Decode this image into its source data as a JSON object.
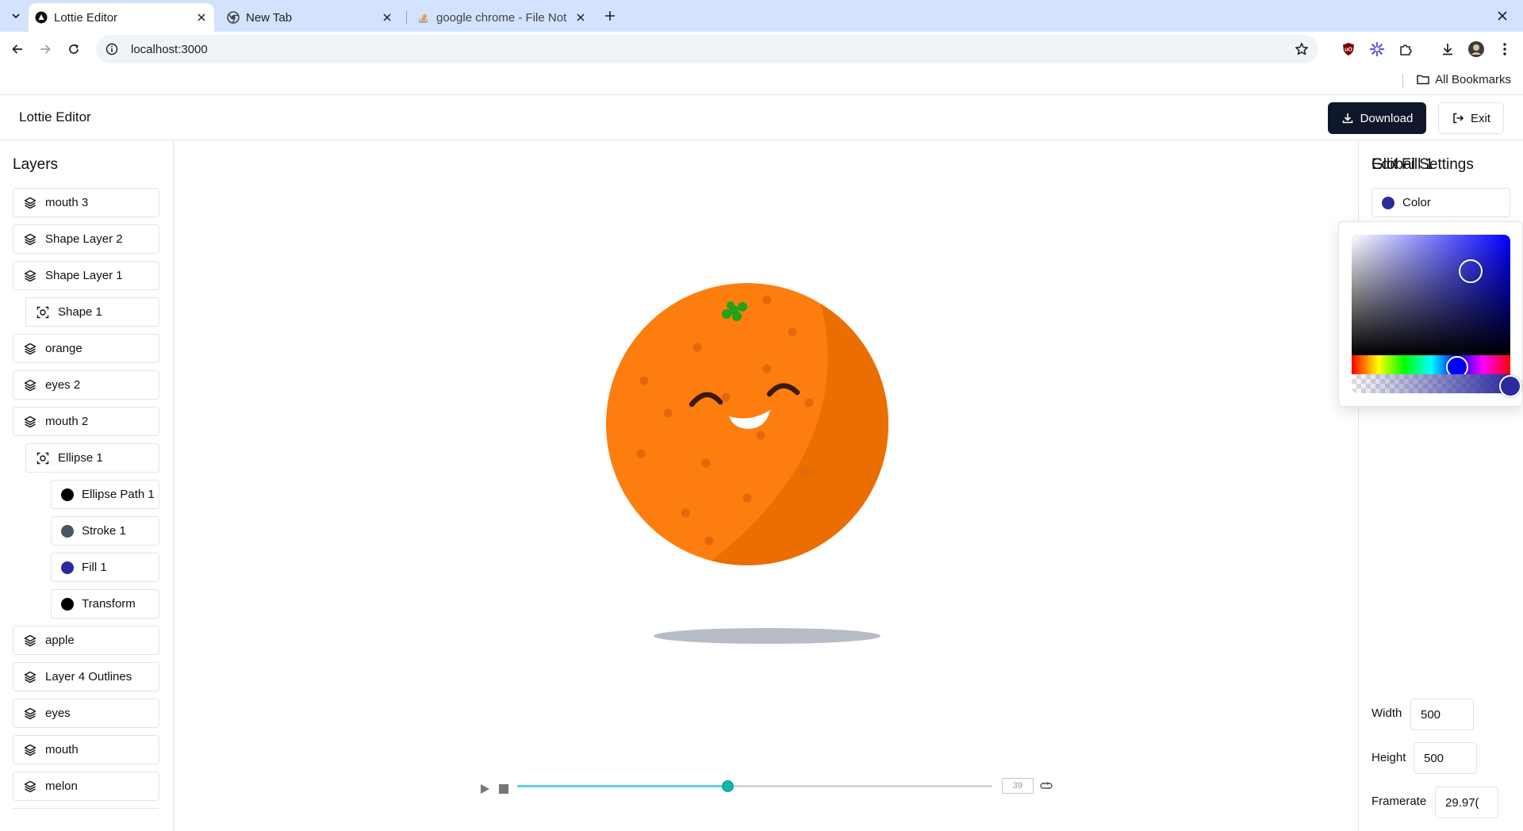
{
  "browser": {
    "tabs": [
      {
        "title": "Lottie Editor",
        "active": true
      },
      {
        "title": "New Tab",
        "active": false
      },
      {
        "title": "google chrome - File Not",
        "active": false
      }
    ],
    "url": "localhost:3000",
    "bookmarks_label": "All Bookmarks"
  },
  "app": {
    "title": "Lottie Editor",
    "download_label": "Download",
    "exit_label": "Exit"
  },
  "layers": {
    "heading": "Layers",
    "items": [
      {
        "label": "mouth 3",
        "kind": "layer"
      },
      {
        "label": "Shape Layer 2",
        "kind": "layer"
      },
      {
        "label": "Shape Layer 1",
        "kind": "layer"
      },
      {
        "label": "Shape 1",
        "kind": "shape"
      },
      {
        "label": "orange",
        "kind": "layer"
      },
      {
        "label": "eyes 2",
        "kind": "layer"
      },
      {
        "label": "mouth 2",
        "kind": "layer"
      },
      {
        "label": "Ellipse 1",
        "kind": "shape"
      },
      {
        "label": "Ellipse Path 1",
        "kind": "prop",
        "color": "#000000"
      },
      {
        "label": "Stroke 1",
        "kind": "prop",
        "color": "#4b5563"
      },
      {
        "label": "Fill 1",
        "kind": "prop",
        "color": "#2b2b9e"
      },
      {
        "label": "Transform",
        "kind": "prop",
        "color": "#000000"
      },
      {
        "label": "apple",
        "kind": "layer"
      },
      {
        "label": "Layer 4 Outlines",
        "kind": "layer"
      },
      {
        "label": "eyes",
        "kind": "layer"
      },
      {
        "label": "mouth",
        "kind": "layer"
      },
      {
        "label": "melon",
        "kind": "layer"
      }
    ]
  },
  "player": {
    "frame": "39",
    "progress": 0.442
  },
  "edit_panel": {
    "heading": "Edit Fill 1",
    "color_label": "Color",
    "color_value": "#2b2b9e",
    "picker": {
      "hue_color": "#0000ff",
      "saturation": 0.75,
      "value": 0.7,
      "hue": 0.667,
      "alpha": 1
    }
  },
  "global_settings": {
    "heading": "Global Settings",
    "width_label": "Width",
    "width_value": "500",
    "height_label": "Height",
    "height_value": "500",
    "framerate_label": "Framerate",
    "framerate_value": "29.97("
  },
  "colors": {
    "orange": "#fd7e0e",
    "orange_shade": "#eb6e00",
    "leaf": "#23a11b",
    "shadow": "#b7bcc6",
    "primary_button": "#0f172a",
    "player_accent": "#14b8a6"
  }
}
